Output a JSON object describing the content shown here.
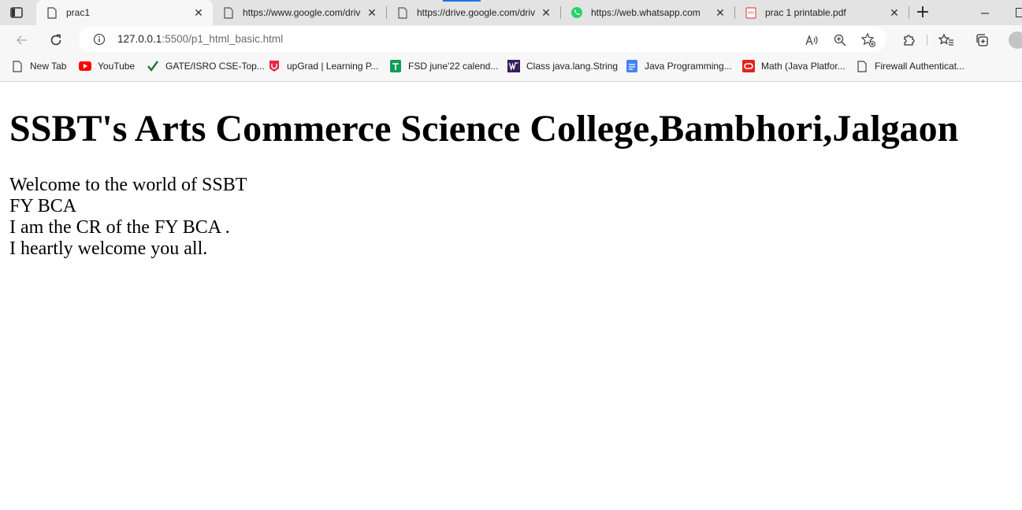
{
  "browser": {
    "tabs": [
      {
        "title": "prac1",
        "icon": "page-icon",
        "active": true
      },
      {
        "title": "https://www.google.com/driv",
        "icon": "page-icon",
        "active": false
      },
      {
        "title": "https://drive.google.com/driv",
        "icon": "page-icon",
        "active": false
      },
      {
        "title": "https://web.whatsapp.com",
        "icon": "whatsapp-icon",
        "active": false
      },
      {
        "title": "prac 1 printable.pdf",
        "icon": "pdf-icon",
        "active": false
      }
    ],
    "address": {
      "host": "127.0.0.1",
      "path": ":5500/p1_html_basic.html"
    },
    "bookmarks": [
      {
        "label": "New Tab",
        "icon": "page-icon"
      },
      {
        "label": "YouTube",
        "icon": "youtube-icon"
      },
      {
        "label": "GATE/ISRO CSE-Top...",
        "icon": "checkmark-icon"
      },
      {
        "label": "upGrad | Learning P...",
        "icon": "upgrad-icon"
      },
      {
        "label": "FSD june'22 calend...",
        "icon": "sheets-icon"
      },
      {
        "label": "Class java.lang.String",
        "icon": "w-icon"
      },
      {
        "label": "Java Programming...",
        "icon": "docs-icon"
      },
      {
        "label": "Math (Java Platfor...",
        "icon": "oracle-icon"
      },
      {
        "label": "Firewall Authenticat...",
        "icon": "page-icon"
      }
    ],
    "colors": {
      "accent": "#1a73e8",
      "tabstrip": "#e3e3e3",
      "toolbar": "#f7f7f7"
    }
  },
  "page": {
    "heading": "SSBT's Arts Commerce Science College,Bambhori,Jalgaon",
    "lines": [
      "Welcome to the world of SSBT",
      "FY BCA",
      "I am the CR of the FY BCA .",
      "I heartly welcome you all."
    ]
  }
}
